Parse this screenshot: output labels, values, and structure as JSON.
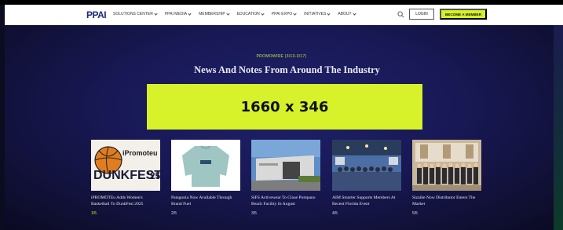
{
  "nav": {
    "logo": "PPAI",
    "items": [
      "SOLUTIONS CENTER",
      "PPAI MEDIA",
      "MEMBERSHIP",
      "EDUCATION",
      "PPAI EXPO",
      "INITIATIVES",
      "ABOUT"
    ],
    "login_label": "LOGIN",
    "member_label": "BECOME A MEMBER",
    "accent": "#d5ef29"
  },
  "hero": {
    "eyebrow": "PROMOWIRE (3/13-3/17)",
    "headline": "News And Notes From Around The Industry",
    "ad_label": "1660 x 346"
  },
  "cards": [
    {
      "title": "iPROMOTEu Adds Women's Basketball To DunkFest 2025",
      "num": "1/5",
      "image": "dunkfest-logo",
      "logo_text_1": "iPromoteu",
      "logo_text_2": "DUNKFEST",
      "logo_text_3": "'25"
    },
    {
      "title": "Patagonia Now Available Through Brand Fuel",
      "num": "2/5",
      "image": "sweater-photo"
    },
    {
      "title": "SiFS Activewear To Close Pompano Beach Facility In August",
      "num": "3/5",
      "image": "building-photo"
    },
    {
      "title": "AIM Smarter Supports Members At Recent Florida Event",
      "num": "4/5",
      "image": "event-photo"
    },
    {
      "title": "Sizable Now Distributor Enters The Market",
      "num": "5/5",
      "image": "group-photo"
    }
  ]
}
